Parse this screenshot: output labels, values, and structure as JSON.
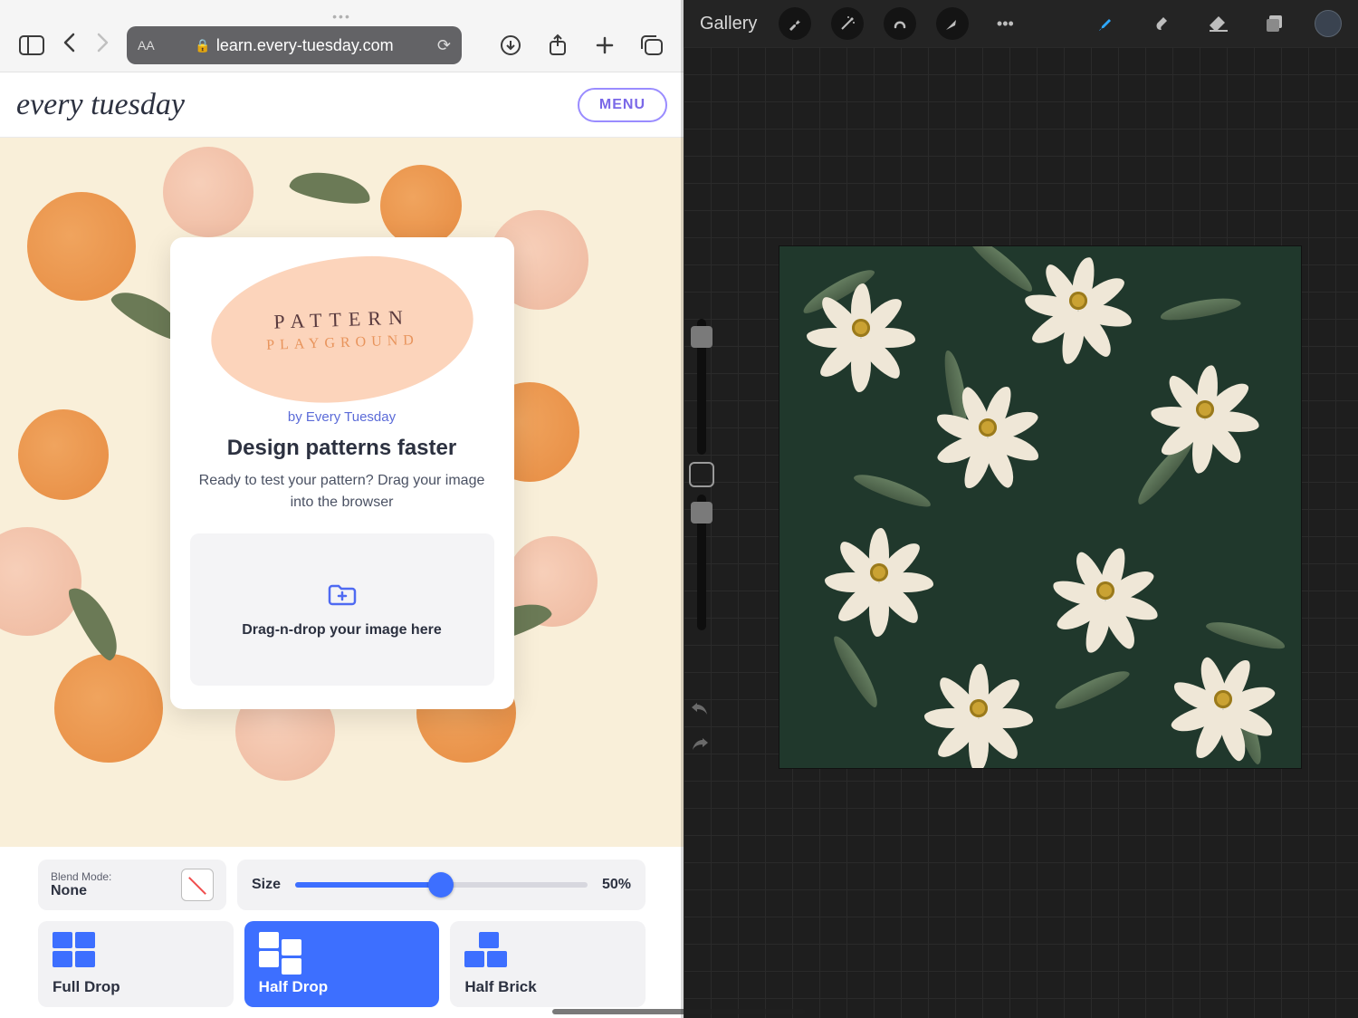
{
  "safari": {
    "url_display": "learn.every-tuesday.com"
  },
  "site": {
    "logo_text": "every tuesday",
    "menu_label": "MENU"
  },
  "hero": {
    "blob_line1": "PATTERN",
    "blob_line2": "PLAYGROUND",
    "byline": "by Every Tuesday",
    "heading": "Design patterns faster",
    "subtext": "Ready to test your pattern? Drag your image into the browser",
    "dropzone_text": "Drag-n-drop your image here"
  },
  "controls": {
    "blend_label": "Blend Mode:",
    "blend_value": "None",
    "size_label": "Size",
    "size_value": "50%",
    "size_percent": 50,
    "drops": [
      {
        "label": "Full Drop",
        "active": false
      },
      {
        "label": "Half Drop",
        "active": true
      },
      {
        "label": "Half Brick",
        "active": false
      }
    ]
  },
  "procreate": {
    "gallery_label": "Gallery"
  }
}
